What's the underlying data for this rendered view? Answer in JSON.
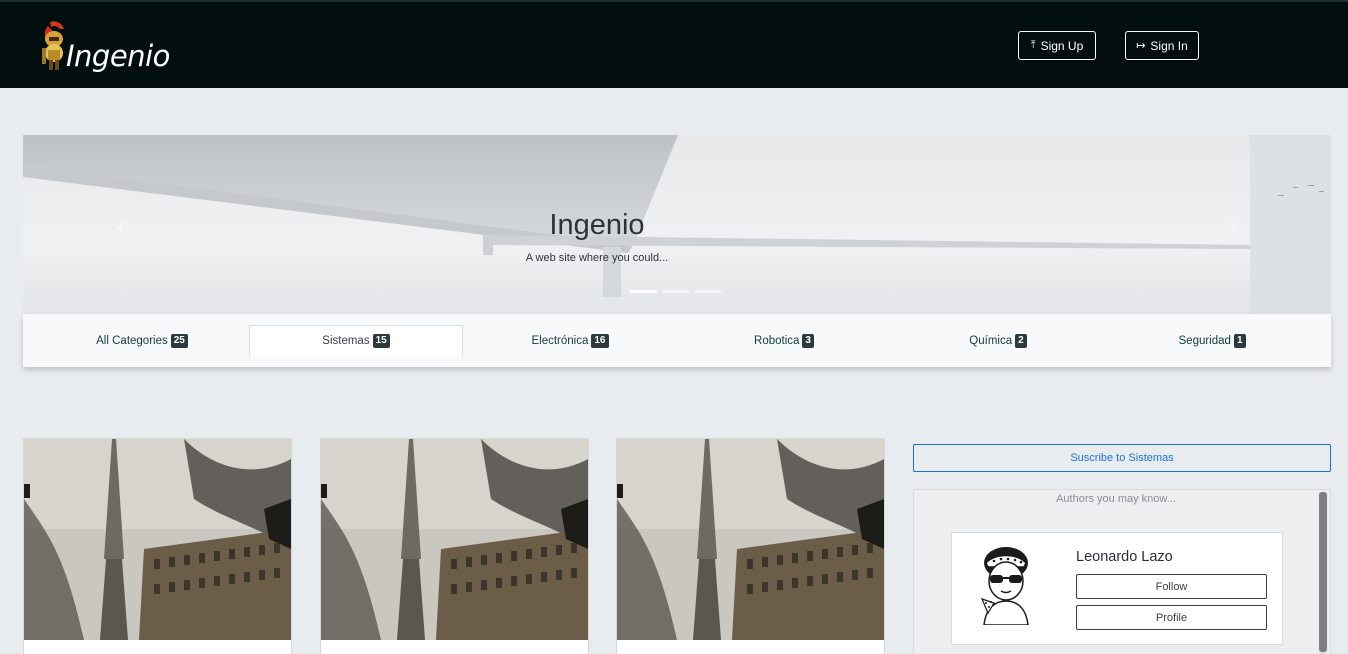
{
  "navbar": {
    "brand_text": "Ingenio",
    "signup_icon": "upload-icon",
    "signup_label": "Sign Up",
    "signin_icon": "sign-in-icon",
    "signin_label": "Sign In",
    "background": "#030f0e"
  },
  "carousel": {
    "title": "Ingenio",
    "subtitle": "A web site where you could...",
    "prev_icon": "chevron-left-icon",
    "next_icon": "chevron-right-icon",
    "slide_count": 3,
    "active_slide": 1
  },
  "categories": [
    {
      "label": "All Categories",
      "count": "25",
      "active": false
    },
    {
      "label": "Sistemas",
      "count": "15",
      "active": true
    },
    {
      "label": "Electrónica",
      "count": "16",
      "active": false
    },
    {
      "label": "Robotica",
      "count": "3",
      "active": false
    },
    {
      "label": "Química",
      "count": "2",
      "active": false
    },
    {
      "label": "Seguridad",
      "count": "1",
      "active": false
    }
  ],
  "sidebar": {
    "subscribe_label": "Suscribe to Sistemas",
    "authors_title": "Authors you may know...",
    "author": {
      "name": "Leonardo Lazo",
      "follow_label": "Follow",
      "profile_label": "Profile"
    }
  },
  "colors": {
    "accent": "#1a73d9",
    "badge": "#2c3a3f",
    "page_bg": "#e9ecef"
  }
}
